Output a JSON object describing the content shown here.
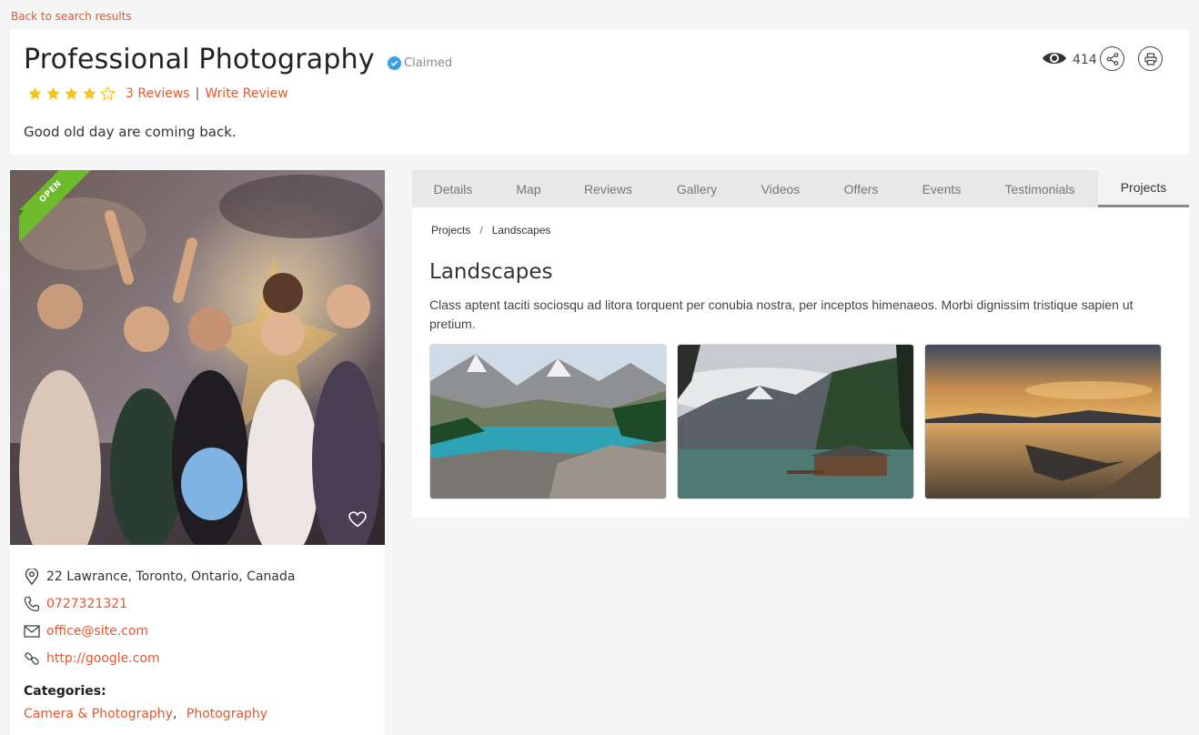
{
  "back_link": "Back to search results",
  "listing": {
    "title": "Professional Photography",
    "claimed_label": "Claimed",
    "rating": 4,
    "rating_max": 5,
    "reviews_link": "3 Reviews",
    "separator": "|",
    "write_review": "Write Review",
    "tagline": "Good old day are coming back.",
    "views": "414"
  },
  "photo": {
    "ribbon": "OPEN"
  },
  "contact": {
    "address": "22 Lawrance, Toronto, Ontario, Canada",
    "phone": "0727321321",
    "email": "office@site.com",
    "website": "http://google.com"
  },
  "categories": {
    "label": "Categories:",
    "items": [
      "Camera & Photography",
      "Photography"
    ],
    "comma": ","
  },
  "tabs": [
    "Details",
    "Map",
    "Reviews",
    "Gallery",
    "Videos",
    "Offers",
    "Events",
    "Testimonials",
    "Projects"
  ],
  "active_tab": "Projects",
  "breadcrumb": {
    "root": "Projects",
    "sep": "/",
    "current": "Landscapes"
  },
  "project": {
    "title": "Landscapes",
    "description": "Class aptent taciti sociosqu ad litora torquent per conubia nostra, per inceptos himenaeos. Morbi dignissim tristique sapien ut pretium."
  },
  "icons": {
    "views": "eye-icon",
    "share": "share-icon",
    "print": "print-icon",
    "favorite": "heart-icon",
    "address": "map-pin-icon",
    "phone": "phone-icon",
    "email": "envelope-icon",
    "website": "link-icon",
    "claimed": "verified-check-icon"
  },
  "colors": {
    "accent": "#e4572e",
    "star": "#f5c518",
    "verified": "#3aa0e6",
    "ribbon": "#6dbb2a"
  }
}
